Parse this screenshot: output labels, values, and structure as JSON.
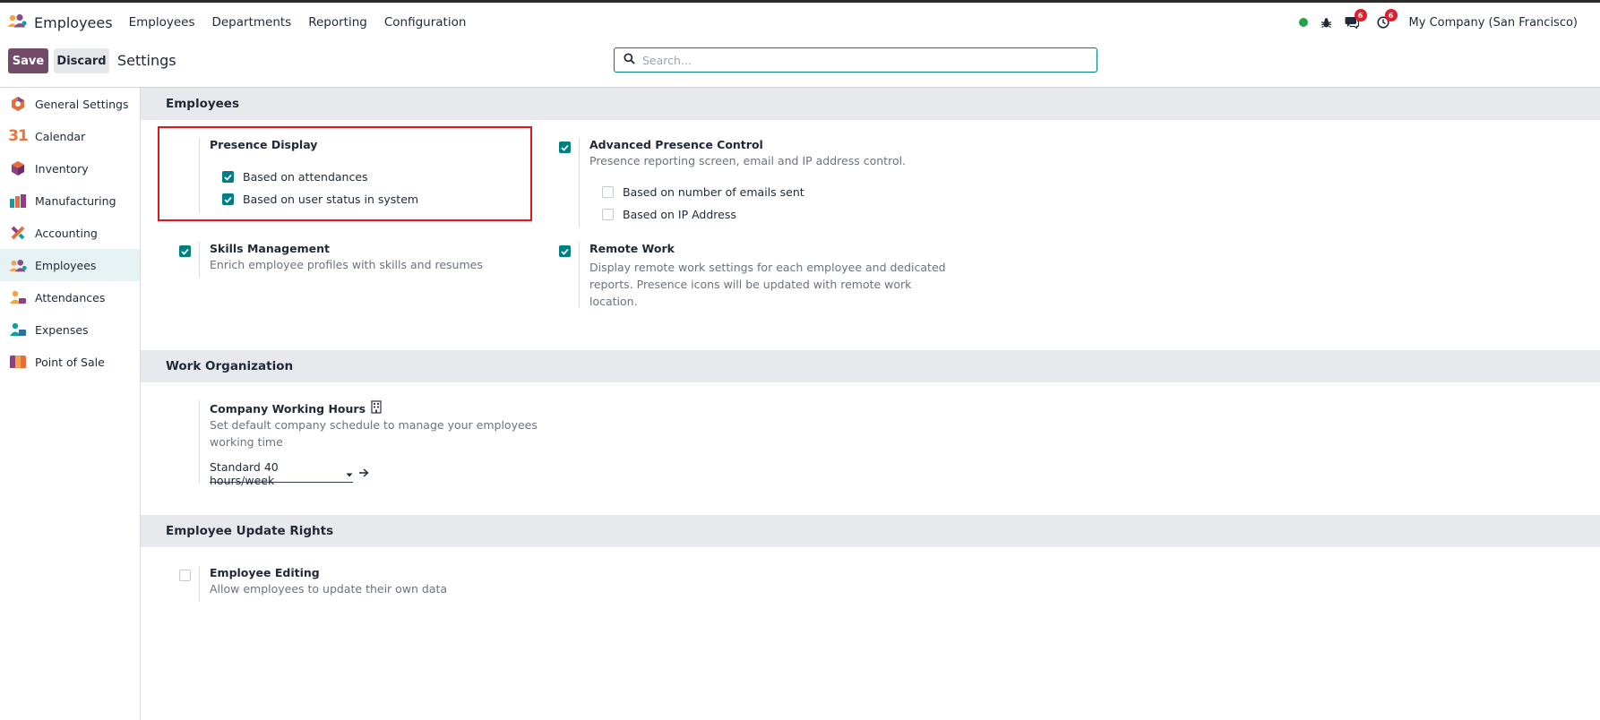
{
  "navbar": {
    "app_name": "Employees",
    "menu": [
      "Employees",
      "Departments",
      "Reporting",
      "Configuration"
    ],
    "chat_count": "6",
    "activity_count": "6",
    "company": "My Company (San Francisco)"
  },
  "control": {
    "save_label": "Save",
    "discard_label": "Discard",
    "title": "Settings",
    "search_placeholder": "Search..."
  },
  "sidebar": {
    "items": [
      {
        "label": "General Settings",
        "icon": "general-settings-icon"
      },
      {
        "label": "Calendar",
        "icon": "calendar-icon"
      },
      {
        "label": "Inventory",
        "icon": "inventory-icon"
      },
      {
        "label": "Manufacturing",
        "icon": "manufacturing-icon"
      },
      {
        "label": "Accounting",
        "icon": "accounting-icon"
      },
      {
        "label": "Employees",
        "icon": "employees-icon"
      },
      {
        "label": "Attendances",
        "icon": "attendances-icon"
      },
      {
        "label": "Expenses",
        "icon": "expenses-icon"
      },
      {
        "label": "Point of Sale",
        "icon": "point-of-sale-icon"
      }
    ],
    "active": "Employees",
    "calendar_glyph": "31"
  },
  "sections": {
    "employees": {
      "title": "Employees",
      "presence_display": {
        "title": "Presence Display",
        "options": [
          {
            "label": "Based on attendances",
            "checked": true
          },
          {
            "label": "Based on user status in system",
            "checked": true
          }
        ]
      },
      "advanced_presence": {
        "title": "Advanced Presence Control",
        "checked": true,
        "desc": "Presence reporting screen, email and IP address control.",
        "options": [
          {
            "label": "Based on number of emails sent",
            "checked": false
          },
          {
            "label": "Based on IP Address",
            "checked": false
          }
        ]
      },
      "skills": {
        "title": "Skills Management",
        "checked": true,
        "desc": "Enrich employee profiles with skills and resumes"
      },
      "remote_work": {
        "title": "Remote Work",
        "checked": true,
        "desc_lines": [
          "Display remote work settings for each employee and dedicated",
          "reports. Presence icons will be updated with remote work",
          "location."
        ]
      }
    },
    "work_org": {
      "title": "Work Organization",
      "working_hours": {
        "title": "Company Working Hours",
        "desc_lines": [
          "Set default company schedule to manage your employees",
          "working time"
        ],
        "value": "Standard 40 hours/week"
      }
    },
    "update_rights": {
      "title": "Employee Update Rights",
      "editing": {
        "title": "Employee Editing",
        "checked": false,
        "desc": "Allow employees to update their own data"
      }
    }
  },
  "colors": {
    "primary": "#714b67",
    "accent": "#017e84",
    "highlight": "#e0141e"
  }
}
